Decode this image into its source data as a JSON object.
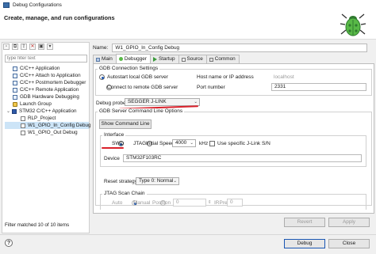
{
  "window": {
    "title": "Debug Configurations"
  },
  "header": {
    "title": "Create, manage, and run configurations"
  },
  "left": {
    "filter_placeholder": "type filter text",
    "tree": [
      {
        "label": "C/C++ Application",
        "level": 1,
        "icon": "c-app-icon"
      },
      {
        "label": "C/C++ Attach to Application",
        "level": 1,
        "icon": "c-attach-icon"
      },
      {
        "label": "C/C++ Postmortem Debugger",
        "level": 1,
        "icon": "c-postmortem-icon"
      },
      {
        "label": "C/C++ Remote Application",
        "level": 1,
        "icon": "c-remote-icon"
      },
      {
        "label": "GDB Hardware Debugging",
        "level": 1,
        "icon": "c-gdb-hw-icon"
      },
      {
        "label": "Launch Group",
        "level": 1,
        "icon": "launch-group-icon"
      },
      {
        "label": "STM32 C/C++ Application",
        "level": 1,
        "icon": "stm32-icon",
        "expanded": true
      },
      {
        "label": "RLP_Project",
        "level": 2,
        "icon": "config-file-icon"
      },
      {
        "label": "W1_GPIO_In_Config Debug",
        "level": 2,
        "icon": "config-file-icon",
        "selected": true
      },
      {
        "label": "W1_GPIO_Out Debug",
        "level": 2,
        "icon": "config-file-icon"
      }
    ],
    "filter_status": "Filter matched 10 of 10 items"
  },
  "config": {
    "name_label": "Name:",
    "name_value": "W1_GPIO_In_Config Debug",
    "tabs": [
      "Main",
      "Debugger",
      "Startup",
      "Source",
      "Common"
    ],
    "active_tab": "Debugger",
    "gdb_group_title": "GDB Connection Settings",
    "autostart_label": "Autostart local GDB server",
    "host_label": "Host name or IP address",
    "host_value": "localhost",
    "remote_label": "Connect to remote GDB server",
    "port_label": "Port number",
    "port_value": "2331",
    "debug_probe_label": "Debug probe",
    "debug_probe_value": "SEGGER J-LINK",
    "server_options_title": "GDB Server Command Line Options",
    "show_cmd_button": "Show Command Line",
    "interface_title": "Interface",
    "swd_label": "SWD",
    "jtag_label": "JTAG",
    "initial_speed_label": "Initial Speed",
    "initial_speed_value": "4000",
    "khz_label": "kHz",
    "jlink_sn_label": "Use specific J-Link S/N",
    "device_label": "Device",
    "device_value": "STM32F103RC",
    "reset_label": "Reset strategy",
    "reset_value": "Type 0: Normal",
    "jtag_chain_title": "JTAG Scan Chain",
    "auto_label": "Auto",
    "manual_label": "Manual",
    "position_label": "Position",
    "position_value": "0",
    "irpre_label": "IRPre",
    "irpre_value": "0",
    "revert_button": "Revert",
    "apply_button": "Apply"
  },
  "footer": {
    "debug_button": "Debug",
    "close_button": "Close"
  },
  "colors": {
    "accent": "#1a56b3",
    "selection": "#cce4f7",
    "annotation_red": "#d9202a"
  }
}
